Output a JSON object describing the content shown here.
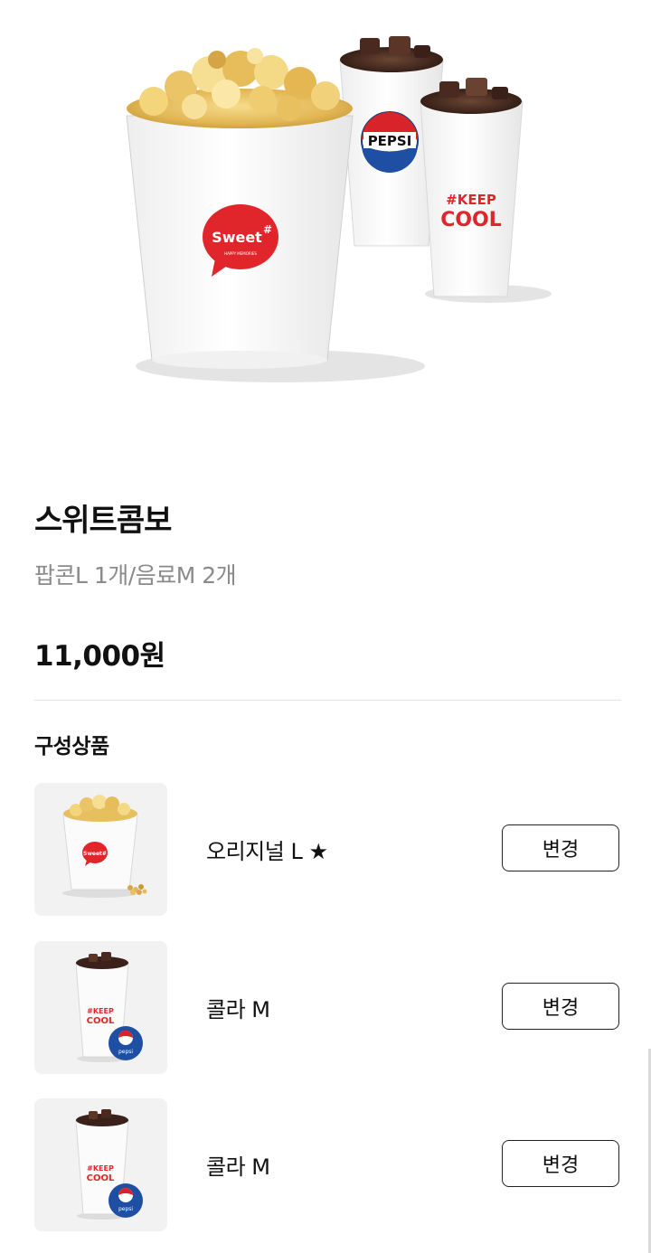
{
  "hero": {
    "image": "popcorn-and-two-drinks",
    "popcorn_logo": "Sweet",
    "popcorn_logo_mark": "#",
    "popcorn_logo_sub": "HAPPY MEMORIES",
    "cup1_logo": "PEPSI",
    "cup2_logo_line1": "#KEEP",
    "cup2_logo_line2": "COOL"
  },
  "product": {
    "name": "스위트콤보",
    "description": "팝콘L 1개/음료M 2개",
    "price": "11,000원"
  },
  "components": {
    "section_title": "구성상품",
    "items": [
      {
        "name": "오리지널 L ★",
        "button": "변경",
        "thumb_icon": "popcorn-icon",
        "logo": "Sweet#"
      },
      {
        "name": "콜라 M",
        "button": "변경",
        "thumb_icon": "cola-cup-icon",
        "logo_line1": "#KEEP",
        "logo_line2": "COOL",
        "badge": "pepsi"
      },
      {
        "name": "콜라 M",
        "button": "변경",
        "thumb_icon": "cola-cup-icon",
        "logo_line1": "#KEEP",
        "logo_line2": "COOL",
        "badge": "pepsi"
      }
    ]
  },
  "colors": {
    "brand_red": "#e0252b",
    "pepsi_blue": "#1f4fa3",
    "pepsi_red": "#d8232a",
    "popcorn": "#e8c46a",
    "cola": "#3a221a"
  }
}
